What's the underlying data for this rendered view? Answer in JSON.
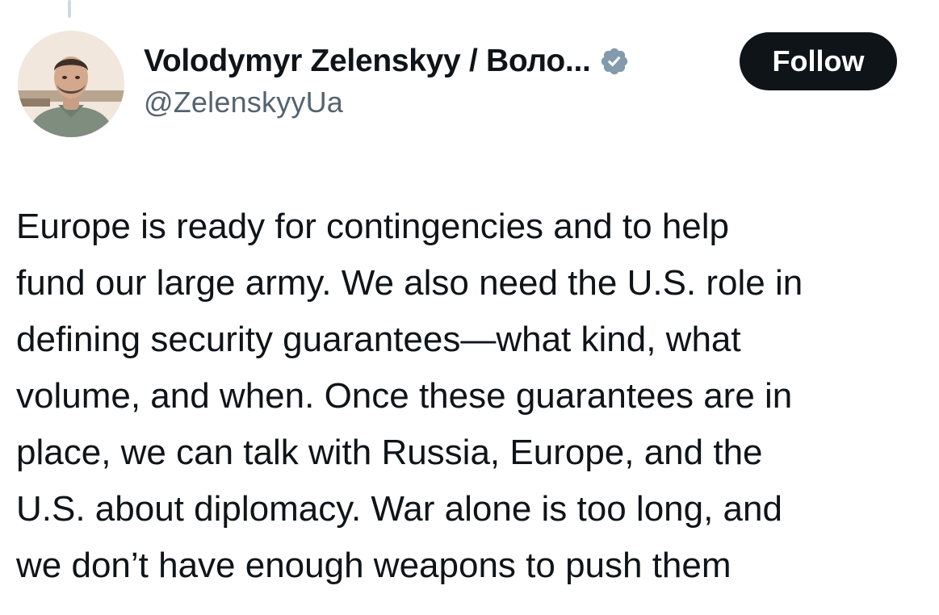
{
  "author": {
    "display_name": "Volodymyr Zelenskyy / Воло...",
    "handle": "@ZelenskyyUa",
    "verified": true,
    "avatar_icon": "profile-photo",
    "verified_icon": "verified-badge-icon"
  },
  "actions": {
    "follow_label": "Follow"
  },
  "tweet": {
    "lines": [
      "Europe is ready for contingencies and to help",
      "fund our large army. We also need the U.S. role in",
      "defining security guarantees—what kind, what",
      "volume, and when. Once these guarantees are in",
      "place, we can talk with Russia, Europe, and the",
      "U.S. about diplomacy. War alone is too long, and",
      "we don’t have enough weapons to push them"
    ]
  },
  "colors": {
    "text_primary": "#0f1419",
    "text_secondary": "#536471",
    "follow_button_bg": "#0f1419",
    "verified_badge": "#829aab"
  }
}
